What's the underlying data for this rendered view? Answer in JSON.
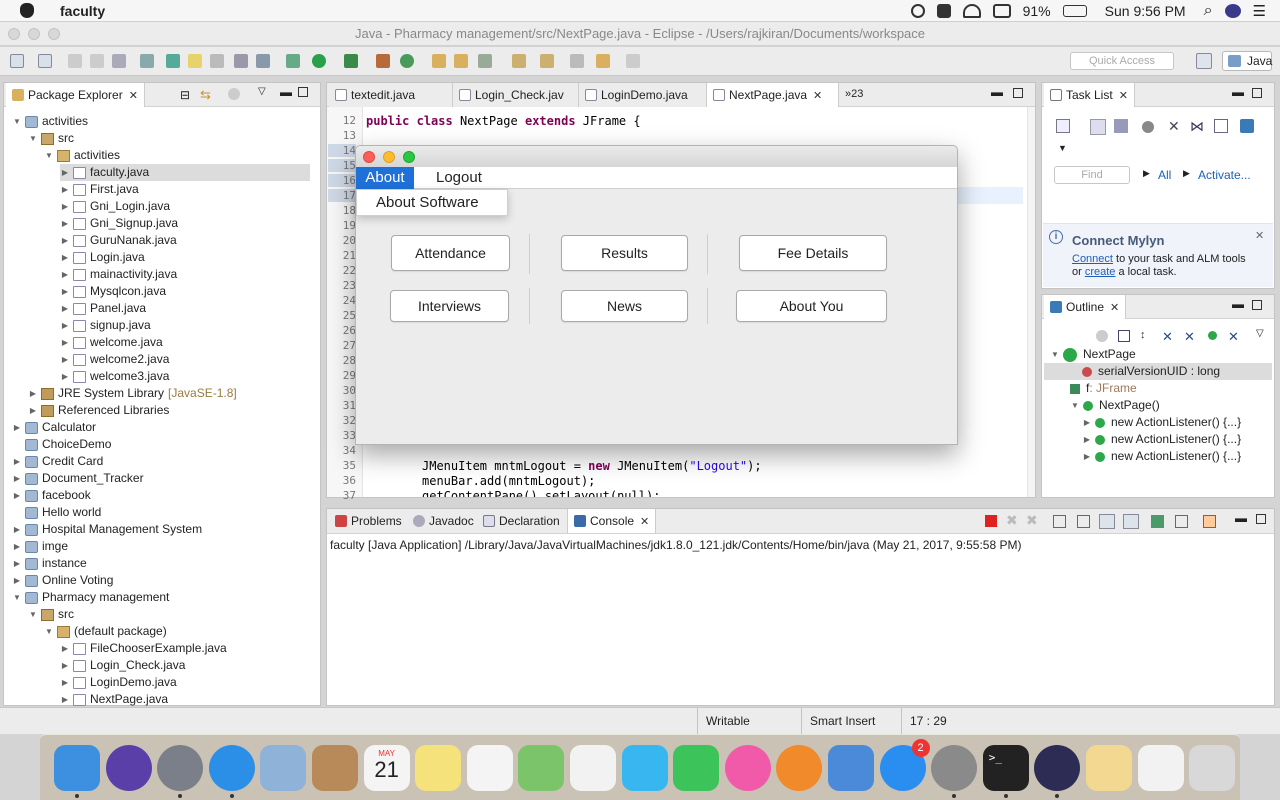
{
  "mac_menubar": {
    "app_name": "faculty",
    "battery": "91%",
    "clock": "Sun 9:56 PM"
  },
  "window": {
    "title": "Java - Pharmacy management/src/NextPage.java - Eclipse - /Users/rajkiran/Documents/workspace",
    "quick_access_placeholder": "Quick Access",
    "perspective": "Java"
  },
  "package_explorer": {
    "tab_label": "Package Explorer",
    "items": [
      {
        "label": "activities",
        "level": 0,
        "icon": "project-icon",
        "open": true
      },
      {
        "label": "src",
        "level": 1,
        "icon": "src-folder-icon",
        "open": true
      },
      {
        "label": "activities",
        "level": 2,
        "icon": "package-icon",
        "open": true
      },
      {
        "label": "faculty.java",
        "level": 3,
        "icon": "java-file-icon",
        "selected": true
      },
      {
        "label": "First.java",
        "level": 3,
        "icon": "java-file-icon"
      },
      {
        "label": "Gni_Login.java",
        "level": 3,
        "icon": "java-file-icon"
      },
      {
        "label": "Gni_Signup.java",
        "level": 3,
        "icon": "java-file-icon"
      },
      {
        "label": "GuruNanak.java",
        "level": 3,
        "icon": "java-file-icon"
      },
      {
        "label": "Login.java",
        "level": 3,
        "icon": "java-file-icon"
      },
      {
        "label": "mainactivity.java",
        "level": 3,
        "icon": "java-file-icon"
      },
      {
        "label": "Mysqlcon.java",
        "level": 3,
        "icon": "java-file-icon"
      },
      {
        "label": "Panel.java",
        "level": 3,
        "icon": "java-file-icon"
      },
      {
        "label": "signup.java",
        "level": 3,
        "icon": "java-file-icon"
      },
      {
        "label": "welcome.java",
        "level": 3,
        "icon": "java-file-icon"
      },
      {
        "label": "welcome2.java",
        "level": 3,
        "icon": "java-file-icon"
      },
      {
        "label": "welcome3.java",
        "level": 3,
        "icon": "java-file-icon"
      },
      {
        "label": "JRE System Library",
        "suffix": "[JavaSE-1.8]",
        "level": 1,
        "icon": "library-icon"
      },
      {
        "label": "Referenced Libraries",
        "level": 1,
        "icon": "library-icon"
      },
      {
        "label": "Calculator",
        "level": 0,
        "icon": "project-icon"
      },
      {
        "label": "ChoiceDemo",
        "level": 0,
        "icon": "folder-icon",
        "leaf": true
      },
      {
        "label": "Credit Card",
        "level": 0,
        "icon": "project-icon"
      },
      {
        "label": "Document_Tracker",
        "level": 0,
        "icon": "project-icon"
      },
      {
        "label": "facebook",
        "level": 0,
        "icon": "project-icon"
      },
      {
        "label": "Hello world",
        "level": 0,
        "icon": "folder-icon",
        "leaf": true
      },
      {
        "label": "Hospital Management System",
        "level": 0,
        "icon": "project-icon"
      },
      {
        "label": "imge",
        "level": 0,
        "icon": "project-icon"
      },
      {
        "label": "instance",
        "level": 0,
        "icon": "project-icon"
      },
      {
        "label": "Online Voting",
        "level": 0,
        "icon": "project-icon"
      },
      {
        "label": "Pharmacy management",
        "level": 0,
        "icon": "project-icon",
        "open": true
      },
      {
        "label": "src",
        "level": 1,
        "icon": "src-folder-icon",
        "open": true
      },
      {
        "label": "(default package)",
        "level": 2,
        "icon": "package-icon",
        "open": true
      },
      {
        "label": "FileChooserExample.java",
        "level": 3,
        "icon": "java-file-icon"
      },
      {
        "label": "Login_Check.java",
        "level": 3,
        "icon": "java-file-icon"
      },
      {
        "label": "LoginDemo.java",
        "level": 3,
        "icon": "java-file-icon"
      },
      {
        "label": "NextPage.java",
        "level": 3,
        "icon": "java-file-icon"
      }
    ]
  },
  "editor": {
    "tabs": [
      {
        "label": "textedit.java",
        "active": false
      },
      {
        "label": "Login_Check.jav",
        "active": false
      },
      {
        "label": "LoginDemo.java",
        "active": false
      },
      {
        "label": "NextPage.java",
        "active": true
      }
    ],
    "overflow_label": "»23",
    "line_numbers": [
      "12",
      "13",
      "14",
      "15",
      "16",
      "17",
      "18",
      "19",
      "20",
      "21",
      "22",
      "23",
      "24",
      "25",
      "26",
      "27",
      "28",
      "29",
      "30",
      "31",
      "32",
      "33",
      "34",
      "35",
      "36",
      "37"
    ],
    "line12": {
      "kw1": "public",
      "kw2": "class",
      "name": "NextPage",
      "kw3": "extends",
      "rest": "JFrame {"
    },
    "line35": {
      "pre": "JMenuItem mntmLogout = ",
      "kw": "new",
      "mid": " JMenuItem(",
      "str": "\"Logout\"",
      "post": ");"
    },
    "line36": "menuBar.add(mntmLogout);",
    "line37": "getContentPane().setLayout(null);"
  },
  "swing_app": {
    "menus": [
      "About",
      "Logout"
    ],
    "dropdown_item": "About Software",
    "buttons": [
      "Attendance",
      "Results",
      "Fee Details",
      "Interviews",
      "News",
      "About You"
    ]
  },
  "task_list": {
    "tab_label": "Task List",
    "find_placeholder": "Find",
    "all_label": "All",
    "activate_label": "Activate...",
    "mylyn_title": "Connect Mylyn",
    "mylyn_connect": "Connect",
    "mylyn_text1": " to your task and ALM tools",
    "mylyn_or": "or ",
    "mylyn_create": "create",
    "mylyn_text2": " a local task."
  },
  "outline": {
    "tab_label": "Outline",
    "class_name": "NextPage",
    "items": [
      {
        "label": "serialVersionUID : long",
        "selected": true
      },
      {
        "label": "f",
        "type": " : JFrame"
      },
      {
        "label": "NextPage()"
      },
      {
        "label": "new ActionListener() {...}"
      },
      {
        "label": "new ActionListener() {...}"
      },
      {
        "label": "new ActionListener() {...}"
      }
    ]
  },
  "bottom": {
    "tabs": [
      "Problems",
      "Javadoc",
      "Declaration",
      "Console"
    ],
    "active_tab": "Console",
    "console_text": "faculty [Java Application] /Library/Java/JavaVirtualMachines/jdk1.8.0_121.jdk/Contents/Home/bin/java (May 21, 2017, 9:55:58 PM)"
  },
  "statusbar": {
    "writable": "Writable",
    "insert_mode": "Smart Insert",
    "position": "17 : 29"
  },
  "dock": {
    "calendar_month": "MAY",
    "calendar_day": "21",
    "appstore_badge": "2",
    "apps": [
      "finder-icon",
      "siri-icon",
      "launchpad-icon",
      "safari-icon",
      "mail-icon",
      "contacts-icon",
      "calendar-icon",
      "notes-icon",
      "reminders-icon",
      "maps-icon",
      "photos-icon",
      "messages-icon",
      "facetime-icon",
      "itunes-icon",
      "ibooks-icon",
      "xcode-icon",
      "app-store-icon",
      "system-preferences-icon",
      "terminal-icon",
      "eclipse-icon",
      "textedit-icon",
      "java-icon",
      "trash-icon"
    ],
    "colors": [
      "#3d8fe0",
      "#5b3fa8",
      "#7a7f8a",
      "#2b8fe8",
      "#8fb3d8",
      "#b88a5a",
      "#f4f4f4",
      "#f6e27a",
      "#f4f4f4",
      "#7cc46a",
      "#f2f2f2",
      "#38b6f0",
      "#3cc45a",
      "#f05aa8",
      "#f08a2a",
      "#4a8ad8",
      "#2a8ef0",
      "#8a8a8a",
      "#222",
      "#2c2c54",
      "#f2d890",
      "#f2f2f2",
      "#d8d8d8"
    ]
  }
}
